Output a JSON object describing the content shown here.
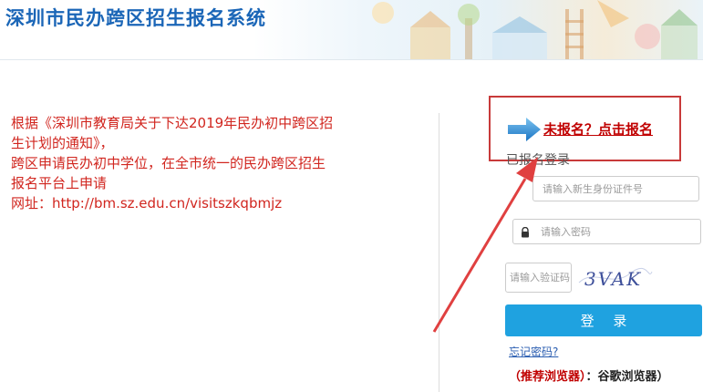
{
  "header": {
    "title": "深圳市民办跨区招生报名系统"
  },
  "notice": {
    "lines": [
      "根据《深圳市教育局关于下达2019年民办初中跨区招",
      "生计划的通知》，",
      "跨区申请民办初中学位，在全市统一的民办跨区招生",
      "报名平台上申请",
      "网址：http://bm.sz.edu.cn/visitszkqbmjz"
    ]
  },
  "login": {
    "register_link": "未报名？点击报名",
    "heading": "已报名登录",
    "id_placeholder": "请输入新生身份证件号",
    "password_placeholder": "请输入密码",
    "captcha_placeholder": "请输入验证码",
    "captcha_text": "3VAK",
    "login_button": "登 录",
    "forgot_password": "忘记密码?",
    "browser_tip_label": "（推荐浏览器）",
    "browser_tip_value": "：谷歌浏览器）"
  },
  "colors": {
    "title_blue": "#1b66b7",
    "notice_red": "#d1261f",
    "button_blue": "#1fa2e0",
    "highlight_red": "#c83a3a"
  }
}
